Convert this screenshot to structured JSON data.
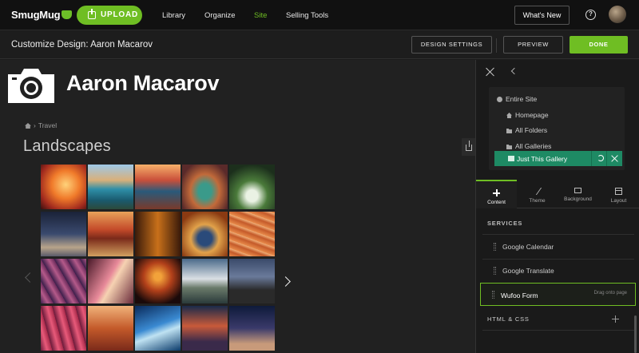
{
  "nav": {
    "logo": "SmugMug",
    "upload": "UPLOAD",
    "links": [
      "Library",
      "Organize",
      "Site",
      "Selling Tools"
    ],
    "active_link": "Site",
    "whats_new": "What's New",
    "help": "?"
  },
  "header": {
    "title": "Customize Design: Aaron Macarov",
    "design_settings": "DESIGN SETTINGS",
    "preview": "PREVIEW",
    "done": "DONE"
  },
  "page": {
    "site_title": "Aaron Macarov",
    "breadcrumb": "Travel",
    "gallery_title": "Landscapes"
  },
  "panel": {
    "scope": {
      "entire_site": "Entire Site",
      "homepage": "Homepage",
      "all_folders": "All Folders",
      "all_galleries": "All Galleries",
      "just_this_gallery": "Just This Gallery"
    },
    "tabs": [
      "Content",
      "Theme",
      "Background",
      "Layout"
    ],
    "services_heading": "SERVICES",
    "services": [
      "Google Calendar",
      "Google Translate",
      "Wufoo Form"
    ],
    "drag_hint": "Drag onto page",
    "html_css_heading": "HTML & CSS"
  },
  "colors": {
    "accent_green": "#6fbe23",
    "selected_teal": "#1e8a64",
    "background": "#1b1b1b"
  }
}
